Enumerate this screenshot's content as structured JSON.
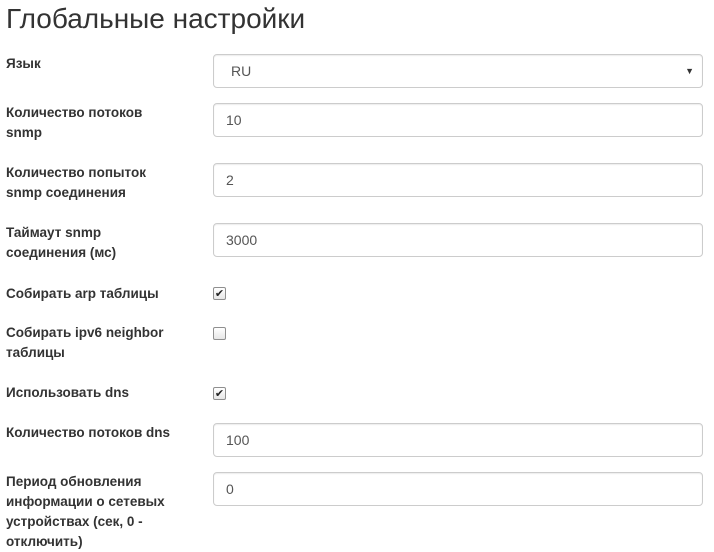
{
  "page": {
    "title": "Глобальные настройки"
  },
  "settings": {
    "language": {
      "label": "Язык",
      "value": "RU",
      "caret": "▼"
    },
    "snmp_threads": {
      "label_line1": "Количество потоков",
      "label_line2": "snmp",
      "value": "10"
    },
    "snmp_retries": {
      "label_line1": "Количество попыток",
      "label_line2": "snmp соединения",
      "value": "2"
    },
    "snmp_timeout": {
      "label_line1": "Таймаут snmp",
      "label_line2": "соединения (мс)",
      "value": "3000"
    },
    "collect_arp": {
      "label": "Собирать arp таблицы",
      "checked": true,
      "mark": "✔"
    },
    "collect_ipv6": {
      "label_line1": "Собирать ipv6 neighbor",
      "label_line2": "таблицы",
      "checked": false,
      "mark": ""
    },
    "use_dns": {
      "label": "Использовать dns",
      "checked": true,
      "mark": "✔"
    },
    "dns_threads": {
      "label": "Количество потоков dns",
      "value": "100"
    },
    "refresh_period": {
      "label_line1": "Период обновления",
      "label_line2": "информации о сетевых",
      "label_line3": "устройствах (сек, 0 -",
      "label_line4": "отключить)",
      "value": "0"
    }
  }
}
